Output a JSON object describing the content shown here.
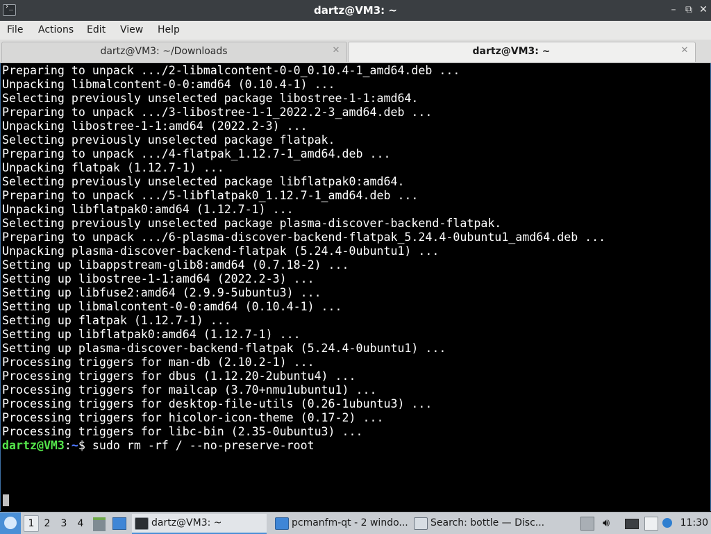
{
  "window": {
    "title": "dartz@VM3: ~",
    "app_icon_glyph": "›_",
    "controls": {
      "minimize": "–",
      "maximize": "⧉",
      "close": "✕"
    }
  },
  "menu": [
    "File",
    "Actions",
    "Edit",
    "View",
    "Help"
  ],
  "tabs": [
    {
      "label": "dartz@VM3: ~/Downloads",
      "active": false
    },
    {
      "label": "dartz@VM3: ~",
      "active": true
    }
  ],
  "tab_close_glyph": "✕",
  "terminal": {
    "lines": [
      "Preparing to unpack .../2-libmalcontent-0-0_0.10.4-1_amd64.deb ...",
      "Unpacking libmalcontent-0-0:amd64 (0.10.4-1) ...",
      "Selecting previously unselected package libostree-1-1:amd64.",
      "Preparing to unpack .../3-libostree-1-1_2022.2-3_amd64.deb ...",
      "Unpacking libostree-1-1:amd64 (2022.2-3) ...",
      "Selecting previously unselected package flatpak.",
      "Preparing to unpack .../4-flatpak_1.12.7-1_amd64.deb ...",
      "Unpacking flatpak (1.12.7-1) ...",
      "Selecting previously unselected package libflatpak0:amd64.",
      "Preparing to unpack .../5-libflatpak0_1.12.7-1_amd64.deb ...",
      "Unpacking libflatpak0:amd64 (1.12.7-1) ...",
      "Selecting previously unselected package plasma-discover-backend-flatpak.",
      "Preparing to unpack .../6-plasma-discover-backend-flatpak_5.24.4-0ubuntu1_amd64.deb ...",
      "Unpacking plasma-discover-backend-flatpak (5.24.4-0ubuntu1) ...",
      "Setting up libappstream-glib8:amd64 (0.7.18-2) ...",
      "Setting up libostree-1-1:amd64 (2022.2-3) ...",
      "Setting up libfuse2:amd64 (2.9.9-5ubuntu3) ...",
      "Setting up libmalcontent-0-0:amd64 (0.10.4-1) ...",
      "Setting up flatpak (1.12.7-1) ...",
      "Setting up libflatpak0:amd64 (1.12.7-1) ...",
      "Setting up plasma-discover-backend-flatpak (5.24.4-0ubuntu1) ...",
      "Processing triggers for man-db (2.10.2-1) ...",
      "Processing triggers for dbus (1.12.20-2ubuntu4) ...",
      "Processing triggers for mailcap (3.70+nmu1ubuntu1) ...",
      "Processing triggers for desktop-file-utils (0.26-1ubuntu3) ...",
      "Processing triggers for hicolor-icon-theme (0.17-2) ...",
      "Processing triggers for libc-bin (2.35-0ubuntu3) ..."
    ],
    "prompt": {
      "user_host": "dartz@VM3",
      "colon": ":",
      "path": "~",
      "symbol": "$ ",
      "command": "sudo rm -rf / --no-preserve-root"
    }
  },
  "taskbar": {
    "workspaces": [
      "1",
      "2",
      "3",
      "4"
    ],
    "active_workspace": "1",
    "tasks": [
      {
        "label": "dartz@VM3: ~",
        "icon": "terminal-icon"
      },
      {
        "label": "pcmanfm-qt - 2 windo...",
        "icon": "folder-icon"
      },
      {
        "label": "Search: bottle — Disc...",
        "icon": "discover-store-icon"
      }
    ],
    "clock": "11:30"
  },
  "colors": {
    "prompt_user": "#54e54a",
    "prompt_path": "#4e79ff",
    "accent": "#4a8fd6",
    "titlebar": "#3a3e42"
  }
}
